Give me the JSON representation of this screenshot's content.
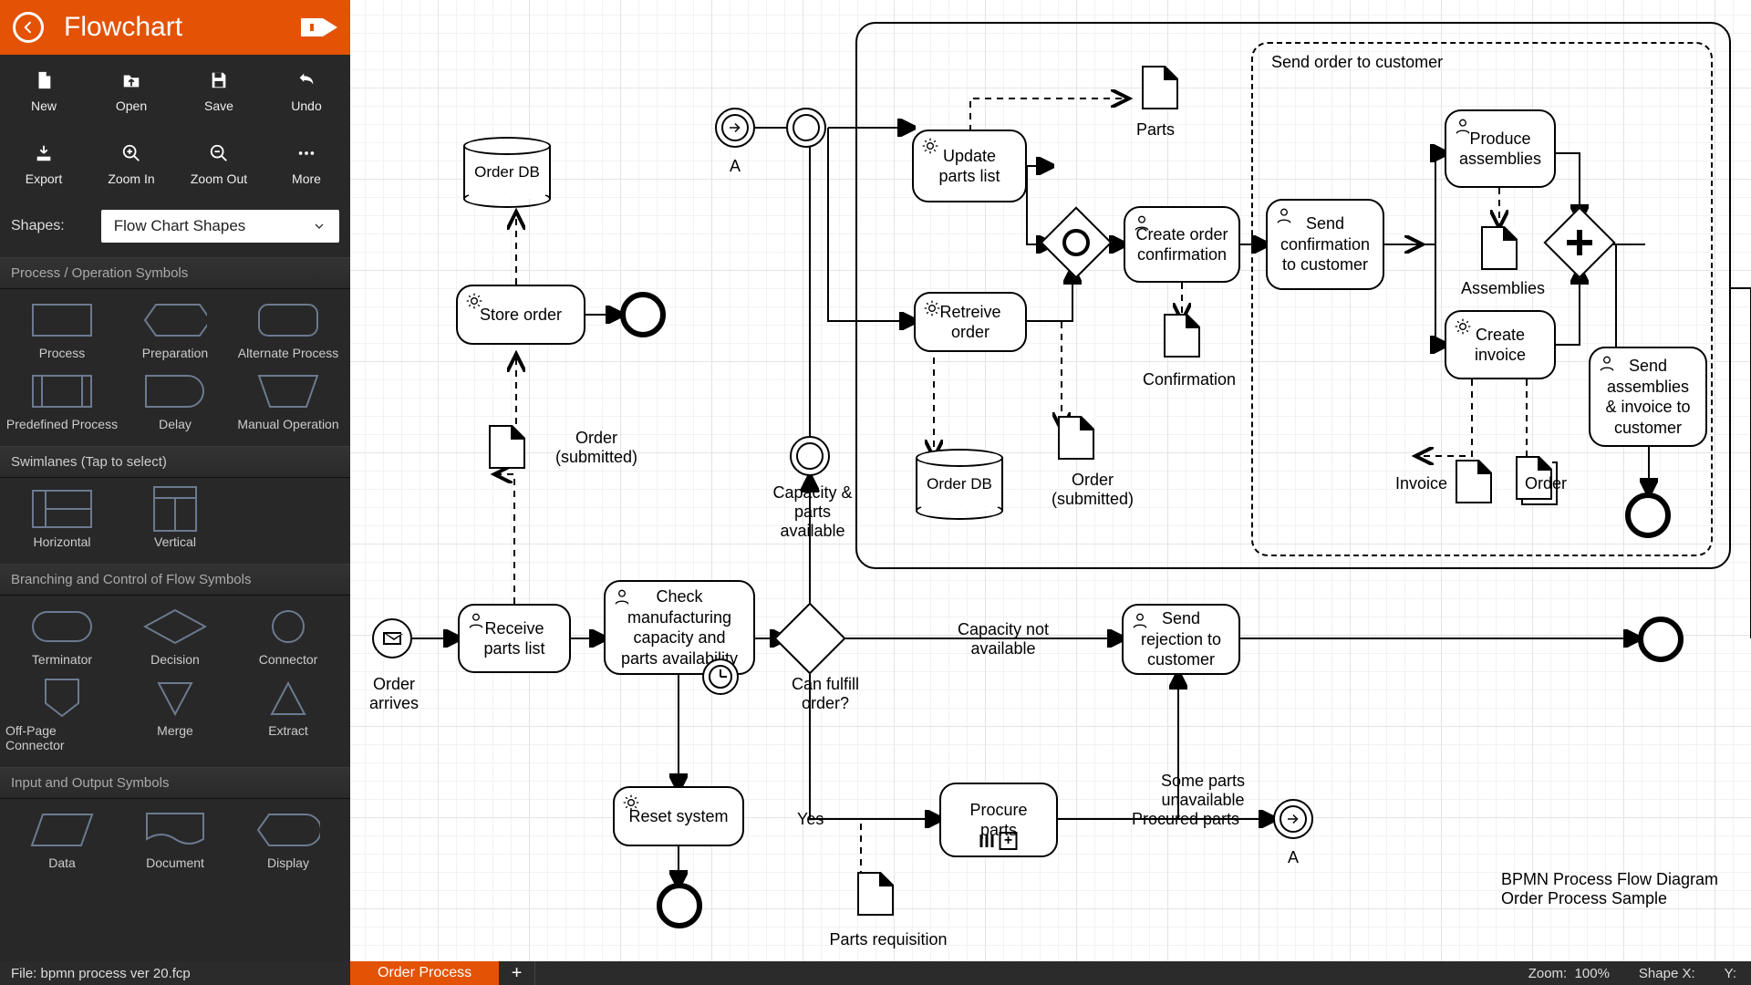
{
  "app": {
    "title": "Flowchart"
  },
  "toolbar": {
    "new": "New",
    "open": "Open",
    "save": "Save",
    "undo": "Undo",
    "export": "Export",
    "zoom_in": "Zoom In",
    "zoom_out": "Zoom Out",
    "more": "More"
  },
  "shapes_label": "Shapes:",
  "shapes_select": "Flow Chart Shapes",
  "categories": {
    "process": "Process / Operation Symbols",
    "swimlanes": "Swimlanes (Tap to select)",
    "branching": "Branching and Control of Flow Symbols",
    "io": "Input and Output Symbols"
  },
  "palette": {
    "process": "Process",
    "preparation": "Preparation",
    "alt_process": "Alternate Process",
    "predef_process": "Predefined Process",
    "delay": "Delay",
    "manual_op": "Manual Operation",
    "horizontal": "Horizontal",
    "vertical": "Vertical",
    "terminator": "Terminator",
    "decision": "Decision",
    "connector": "Connector",
    "offpage": "Off-Page Connector",
    "merge": "Merge",
    "extract": "Extract",
    "data": "Data",
    "document": "Document",
    "display": "Display"
  },
  "nodes": {
    "order_db": "Order DB",
    "store_order": "Store order",
    "order_submitted": "Order\n(submitted)",
    "receive_parts": "Receive parts list",
    "order_arrives": "Order arrives",
    "check_cap": "Check manufacturing capacity and parts availability",
    "reset_system": "Reset system",
    "can_fulfill": "Can fulfill order?",
    "yes": "Yes",
    "cap_parts_avail": "Capacity & parts available",
    "cap_not_avail": "Capacity not available",
    "parts_req": "Parts requisition",
    "procure_parts": "Procure parts",
    "some_parts": "Some parts unavailable",
    "procured_parts": "Procured parts",
    "a": "A",
    "send_rejection": "Send rejection to customer",
    "update_parts": "Update parts list",
    "parts": "Parts",
    "retrieve_order": "Retreive order",
    "order_db2": "Order DB",
    "order_submitted2": "Order\n(submitted)",
    "confirmation": "Confirmation",
    "create_order_conf": "Create order confirmation",
    "send_conf": "Send confirmation to customer",
    "assemblies": "Assemblies",
    "produce_assemblies": "Produce assemblies",
    "create_invoice": "Create invoice",
    "invoice": "Invoice",
    "order": "Order",
    "send_assemblies": "Send assemblies & invoice to customer",
    "group_title": "Send order to customer"
  },
  "caption": {
    "line1": "BPMN Process Flow Diagram",
    "line2": "Order Process Sample"
  },
  "status": {
    "file_prefix": "File:  ",
    "file": "bpmn process ver 20.fcp",
    "tab": "Order Process",
    "zoom_label": "Zoom:",
    "zoom_value": "100%",
    "shape_x": "Shape X:",
    "y": "Y:"
  }
}
